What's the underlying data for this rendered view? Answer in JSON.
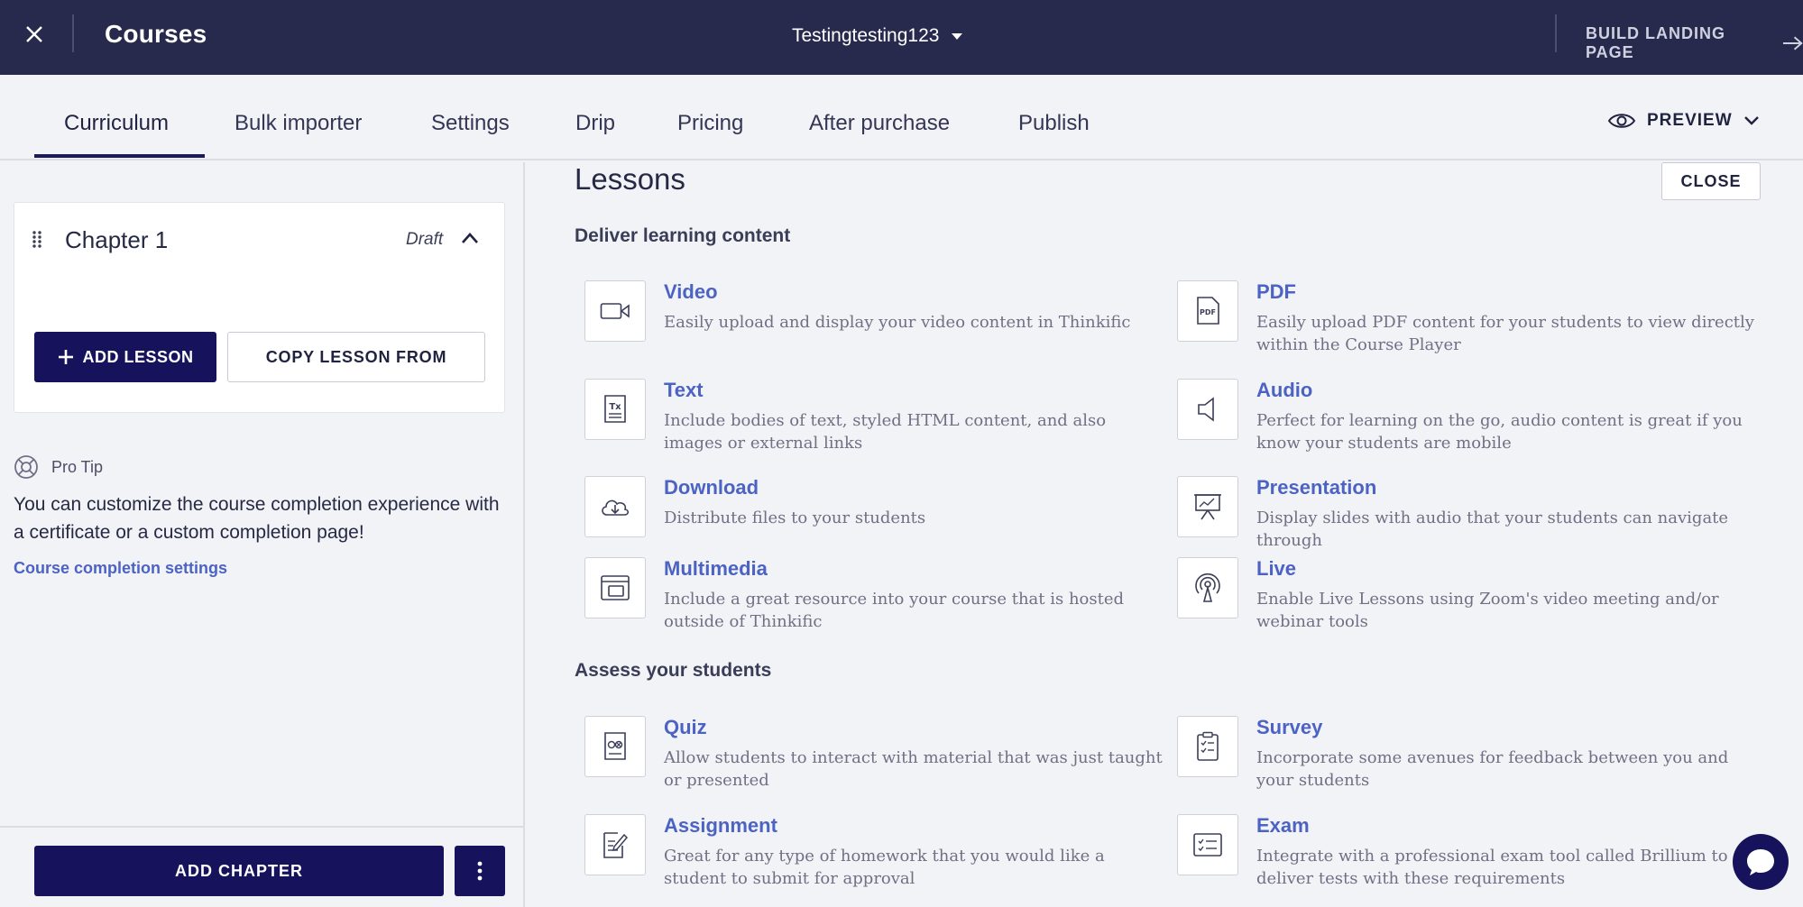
{
  "topbar": {
    "title": "Courses",
    "course_name": "Testingtesting123",
    "build_label": "BUILD LANDING PAGE"
  },
  "tabs": [
    {
      "label": "Curriculum",
      "active": true
    },
    {
      "label": "Bulk importer"
    },
    {
      "label": "Settings"
    },
    {
      "label": "Drip"
    },
    {
      "label": "Pricing"
    },
    {
      "label": "After purchase"
    },
    {
      "label": "Publish"
    }
  ],
  "preview_label": "PREVIEW",
  "chapter": {
    "title": "Chapter 1",
    "status": "Draft",
    "add_lesson_label": "ADD LESSON",
    "copy_lesson_label": "COPY LESSON FROM"
  },
  "pro_tip": {
    "heading": "Pro Tip",
    "text": "You can customize the course completion experience with a certificate or a custom completion page!",
    "link": "Course completion settings"
  },
  "footer": {
    "add_chapter_label": "ADD CHAPTER"
  },
  "lessons": {
    "title": "Lessons",
    "close_label": "CLOSE",
    "deliver_heading": "Deliver learning content",
    "assess_heading": "Assess your students",
    "deliver": [
      {
        "title": "Video",
        "desc": "Easily upload and display your video content in Thinkific",
        "icon": "video-icon"
      },
      {
        "title": "PDF",
        "desc": "Easily upload PDF content for your students to view directly within the Course Player",
        "icon": "pdf-icon"
      },
      {
        "title": "Text",
        "desc": "Include bodies of text, styled HTML content, and also images or external links",
        "icon": "text-icon"
      },
      {
        "title": "Audio",
        "desc": "Perfect for learning on the go, audio content is great if you know your students are mobile",
        "icon": "audio-icon"
      },
      {
        "title": "Download",
        "desc": "Distribute files to your students",
        "icon": "download-icon"
      },
      {
        "title": "Presentation",
        "desc": "Display slides with audio that your students can navigate through",
        "icon": "presentation-icon"
      },
      {
        "title": "Multimedia",
        "desc": "Include a great resource into your course that is hosted outside of Thinkific",
        "icon": "multimedia-icon"
      },
      {
        "title": "Live",
        "desc": "Enable Live Lessons using Zoom's video meeting and/or webinar tools",
        "icon": "live-icon"
      }
    ],
    "assess": [
      {
        "title": "Quiz",
        "desc": "Allow students to interact with material that was just taught or presented",
        "icon": "quiz-icon"
      },
      {
        "title": "Survey",
        "desc": "Incorporate some avenues for feedback between you and your students",
        "icon": "survey-icon"
      },
      {
        "title": "Assignment",
        "desc": "Great for any type of homework that you would like a student to submit for approval",
        "icon": "assignment-icon"
      },
      {
        "title": "Exam",
        "desc": "Integrate with a professional exam tool called Brillium to deliver tests with these requirements",
        "icon": "exam-icon"
      }
    ]
  },
  "colors": {
    "topbar_bg": "#272a4d",
    "primary": "#16135c",
    "link": "#4c63c4",
    "page_bg": "#f2f3f6"
  }
}
